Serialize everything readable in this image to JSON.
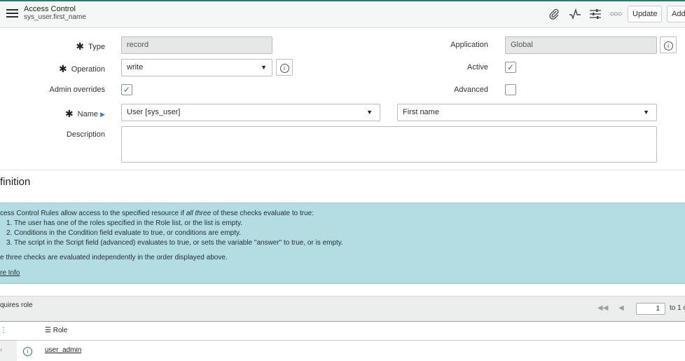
{
  "header": {
    "title": "Access Control",
    "subtitle": "sys_user.first_name",
    "icons": [
      "paperclip-icon",
      "activity-icon",
      "settings-sliders-icon",
      "more-icon"
    ],
    "buttons": {
      "update": "Update",
      "add": "Add"
    }
  },
  "form": {
    "type": {
      "label": "Type",
      "value": "record"
    },
    "operation": {
      "label": "Operation",
      "value": "write"
    },
    "admin_overrides": {
      "label": "Admin overrides",
      "checked": true
    },
    "name": {
      "label": "Name",
      "table_value": "User [sys_user]",
      "field_value": "First name"
    },
    "description": {
      "label": "Description",
      "value": ""
    },
    "application": {
      "label": "Application",
      "value": "Global"
    },
    "active": {
      "label": "Active",
      "checked": true
    },
    "advanced": {
      "label": "Advanced",
      "checked": false
    },
    "required_marker": "✱"
  },
  "definition": {
    "title": "finition",
    "intro_a": "cess Control Rules allow access to the specified resource if ",
    "intro_em": "all three",
    "intro_b": " of these checks evaluate to true:",
    "item1_a": "1. The user has one of the roles specified in the ",
    "item1_b": "Role",
    "item1_c": " list, or the list is empty.",
    "item2_a": "2. Conditions in the ",
    "item2_b": "Condition",
    "item2_c": " field evaluate to true, or conditions are empty.",
    "item3_a": "3. The script in the ",
    "item3_b": "Script",
    "item3_c": " field (advanced) evaluates to true, or sets the variable \"answer\" to true, or is empty.",
    "note": "e three checks are evaluated independently in the order displayed above.",
    "more_info": "re Info"
  },
  "related_list": {
    "title": "quires role",
    "page": "1",
    "page_of": "to 1 o",
    "column": "Role",
    "rows": [
      {
        "role": "user_admin"
      }
    ]
  },
  "colors": {
    "accent": "#2d7a6b",
    "info_bg": "#b4dde3",
    "header_bg": "#f5f6f6"
  }
}
